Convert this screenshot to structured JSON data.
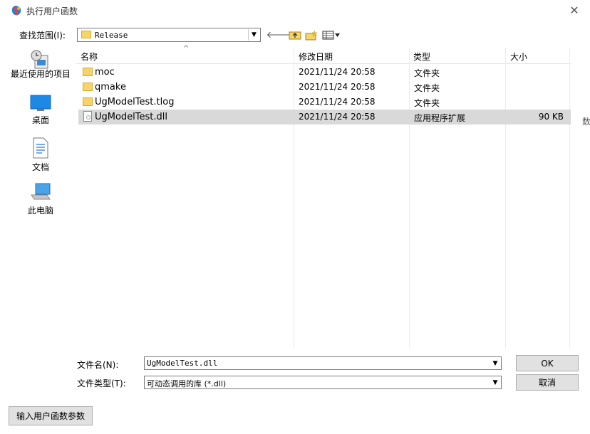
{
  "window": {
    "title": "执行用户函数",
    "close_glyph": "✕"
  },
  "look_in": {
    "label": "查找范围(I):",
    "value": "Release"
  },
  "toolbar": {
    "back_glyph": "🡐",
    "up_glyph": "⮤",
    "new_folder_glyph": "✱",
    "view_glyph": "▦▾"
  },
  "places": [
    {
      "label": "最近使用的项目",
      "icon": "recent-icon"
    },
    {
      "label": "桌面",
      "icon": "desktop-icon"
    },
    {
      "label": "文档",
      "icon": "documents-icon"
    },
    {
      "label": "此电脑",
      "icon": "computer-icon"
    }
  ],
  "columns": {
    "name": "名称",
    "date": "修改日期",
    "type": "类型",
    "size": "大小"
  },
  "files": [
    {
      "name": "moc",
      "date": "2021/11/24 20:58",
      "type": "文件夹",
      "size": "",
      "kind": "folder"
    },
    {
      "name": "qmake",
      "date": "2021/11/24 20:58",
      "type": "文件夹",
      "size": "",
      "kind": "folder"
    },
    {
      "name": "UgModelTest.tlog",
      "date": "2021/11/24 20:58",
      "type": "文件夹",
      "size": "",
      "kind": "folder"
    },
    {
      "name": "UgModelTest.dll",
      "date": "2021/11/24 20:58",
      "type": "应用程序扩展",
      "size": "90 KB",
      "kind": "dll"
    }
  ],
  "filename": {
    "label": "文件名(N):",
    "value": "UgModelTest.dll"
  },
  "filetype": {
    "label": "文件类型(T):",
    "value": "可动态调用的库 (*.dll)"
  },
  "buttons": {
    "ok": "OK",
    "cancel": "取消",
    "input_params": "输入用户函数参数"
  },
  "right_edge_text": "数"
}
